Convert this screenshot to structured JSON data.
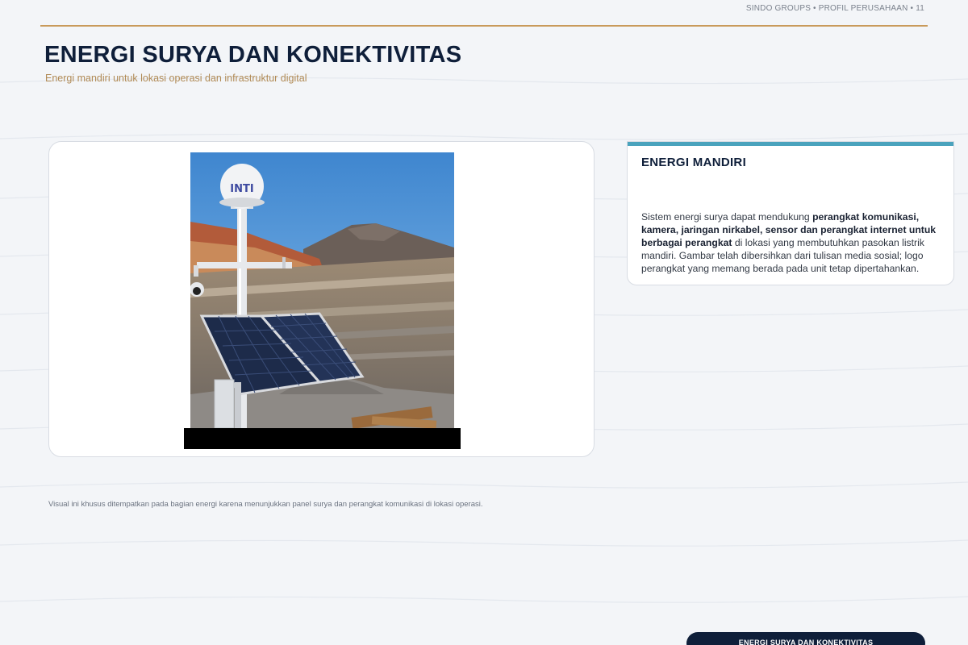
{
  "header": {
    "meta": "SINDO GROUPS • PROFIL PERUSAHAAN • 11"
  },
  "title": "ENERGI SURYA DAN KONEKTIVITAS",
  "subtitle": "Energi mandiri untuk lokasi operasi dan infrastruktur digital",
  "info_card": {
    "title": "ENERGI MANDIRI",
    "body_intro": "Sistem energi surya dapat mendukung ",
    "body_bold": "perangkat komunikasi, kamera, jaringan nirkabel, sensor dan perangkat internet untuk berbagai perangkat",
    "body_rest": " di lokasi yang membutuhkan pasokan listrik mandiri. Gambar telah dibersihkan dari tulisan media sosial; logo perangkat yang memang berada pada unit tetap dipertahankan."
  },
  "photo": {
    "dome_logo": "INTI",
    "colors": {
      "sky": "#3f86cf",
      "panel": "#1d2b4a"
    }
  },
  "caption": "Visual ini khusus ditempatkan pada bagian energi karena menunjukkan panel surya dan perangkat komunikasi di lokasi operasi.",
  "footer": {
    "label": "ENERGI SURYA DAN KONEKTIVITAS"
  },
  "colors": {
    "accent_gold": "#c99a5b",
    "accent_teal": "#4aa3bd",
    "navy": "#0f1f3a"
  }
}
